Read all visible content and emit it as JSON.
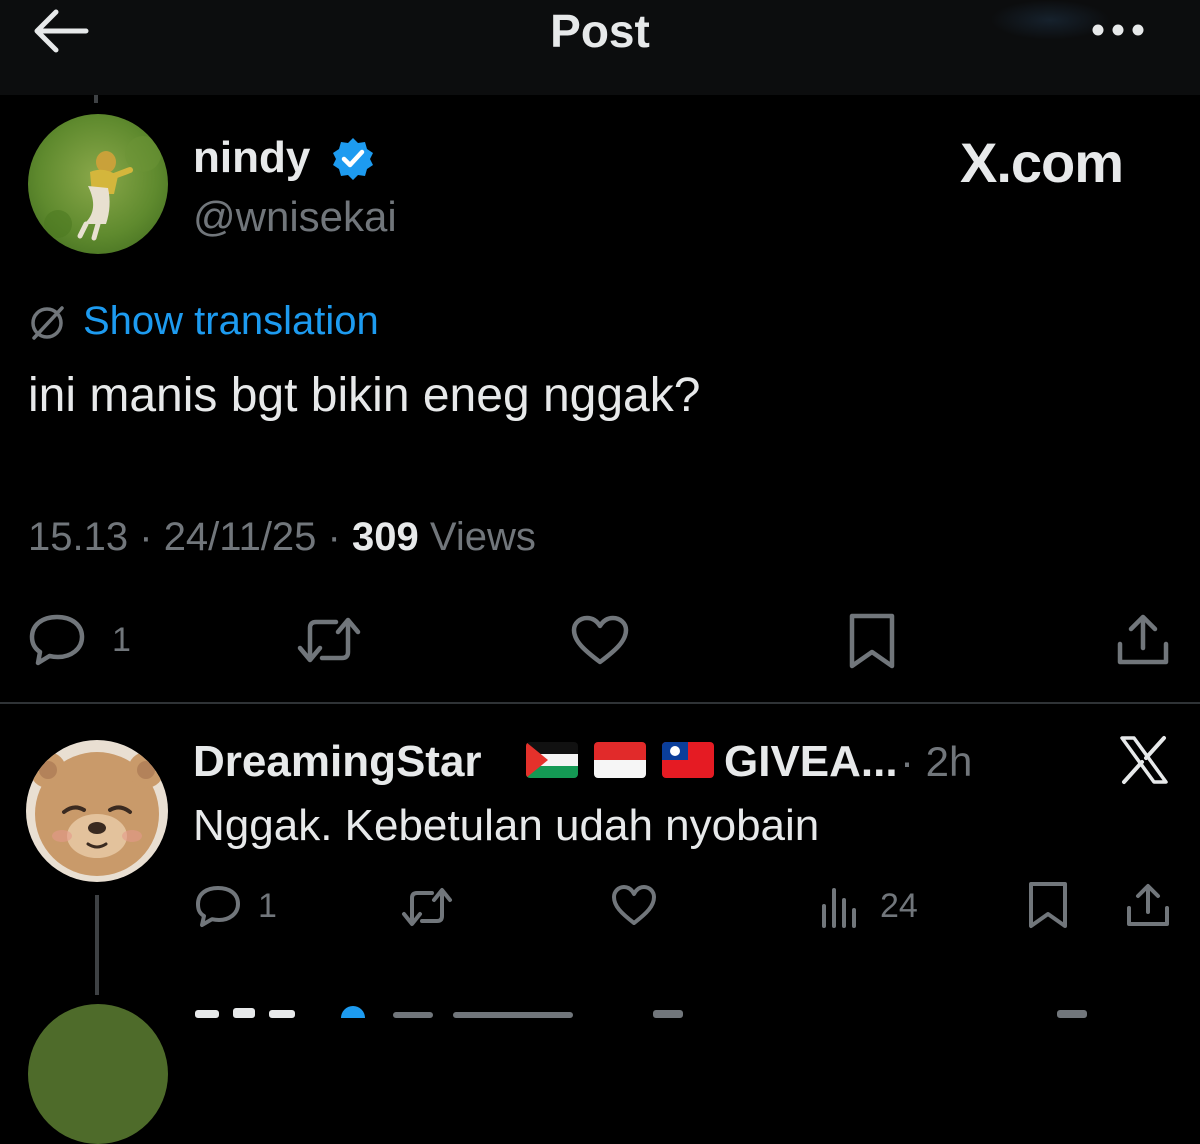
{
  "header": {
    "title": "Post",
    "back_icon": "arrow-left-icon",
    "more_icon": "more-horizontal-icon"
  },
  "post": {
    "display_name": "nindy",
    "verified": true,
    "handle": "@wnisekai",
    "source_label": "X.com",
    "translate_link": "Show translation",
    "text": "ini manis bgt bikin eneg nggak?",
    "time": "15.13",
    "date": "24/11/25",
    "separator": "·",
    "views_count": "309",
    "views_label": "Views",
    "actions": {
      "reply_count": "1"
    }
  },
  "reply": {
    "display_name": "DreamingStar",
    "flags": [
      "Palestine",
      "Indonesia",
      "Taiwan"
    ],
    "name_suffix": "GIVEA...",
    "time": "· 2h",
    "text": "Nggak. Kebetulan udah nyobain",
    "actions": {
      "reply_count": "1",
      "views_count": "24"
    }
  },
  "colors": {
    "background": "#000000",
    "text_primary": "#e7e9ea",
    "text_secondary": "#71767b",
    "accent_blue": "#1d9bf0",
    "divider": "#2f3336"
  }
}
